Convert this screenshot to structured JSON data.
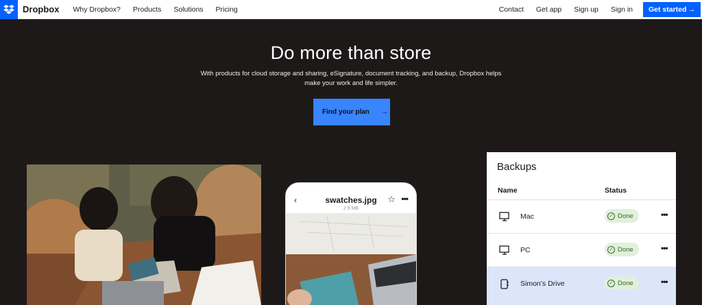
{
  "nav": {
    "brand": "Dropbox",
    "links": [
      "Why Dropbox?",
      "Products",
      "Solutions",
      "Pricing"
    ],
    "right_links": [
      "Contact",
      "Get app",
      "Sign up",
      "Sign in"
    ],
    "cta": "Get started",
    "cta_arrow": "→"
  },
  "hero": {
    "title": "Do more than store",
    "subtitle": "With products for cloud storage and sharing, eSignature, document tracking, and backup, Dropbox helps make your work and life simpler.",
    "button": "Find your plan",
    "button_arrow": "→"
  },
  "phone": {
    "back": "‹",
    "file_name": "swatches.jpg",
    "file_size": "2.9 MB",
    "star": "☆",
    "more": "•••"
  },
  "backups": {
    "title": "Backups",
    "col_name": "Name",
    "col_status": "Status",
    "rows": [
      {
        "name": "Mac",
        "status": "Done",
        "icon": "monitor-icon",
        "more": "•••"
      },
      {
        "name": "PC",
        "status": "Done",
        "icon": "monitor-icon",
        "more": "•••"
      },
      {
        "name": "Simon’s Drive",
        "status": "Done",
        "icon": "drive-icon",
        "more": "•••"
      }
    ]
  },
  "colors": {
    "brand_blue": "#0061fe",
    "hero_bg": "#1e1919",
    "button_blue": "#3984ff",
    "done_green": "#e2efdc",
    "selected_row": "#dbe6fb"
  }
}
